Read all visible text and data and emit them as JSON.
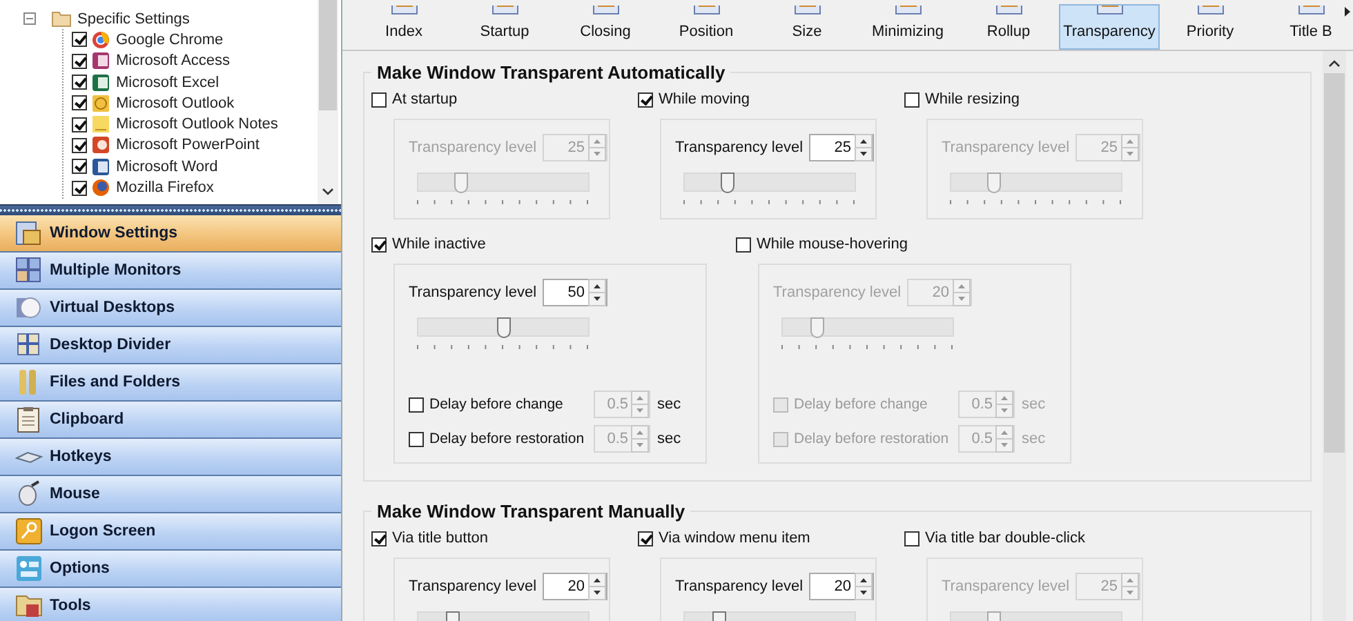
{
  "tree": {
    "items": [
      {
        "label": "Specific Settings",
        "kind": "folder",
        "expanded": true,
        "children": [
          {
            "label": "Google Chrome",
            "checked": true
          },
          {
            "label": "Microsoft Access",
            "checked": true
          },
          {
            "label": "Microsoft Excel",
            "checked": true
          },
          {
            "label": "Microsoft Outlook",
            "checked": true
          },
          {
            "label": "Microsoft Outlook Notes",
            "checked": true
          },
          {
            "label": "Microsoft PowerPoint",
            "checked": true
          },
          {
            "label": "Microsoft Word",
            "checked": true
          },
          {
            "label": "Mozilla Firefox",
            "checked": true
          }
        ]
      }
    ]
  },
  "nav": [
    {
      "label": "Window Settings",
      "selected": true
    },
    {
      "label": "Multiple Monitors",
      "selected": false
    },
    {
      "label": "Virtual Desktops",
      "selected": false
    },
    {
      "label": "Desktop Divider",
      "selected": false
    },
    {
      "label": "Files and Folders",
      "selected": false
    },
    {
      "label": "Clipboard",
      "selected": false
    },
    {
      "label": "Hotkeys",
      "selected": false
    },
    {
      "label": "Mouse",
      "selected": false
    },
    {
      "label": "Logon Screen",
      "selected": false
    },
    {
      "label": "Options",
      "selected": false
    },
    {
      "label": "Tools",
      "selected": false
    }
  ],
  "tabs": [
    {
      "label": "Index",
      "selected": false
    },
    {
      "label": "Startup",
      "selected": false
    },
    {
      "label": "Closing",
      "selected": false
    },
    {
      "label": "Position",
      "selected": false
    },
    {
      "label": "Size",
      "selected": false
    },
    {
      "label": "Minimizing",
      "selected": false
    },
    {
      "label": "Rollup",
      "selected": false
    },
    {
      "label": "Transparency",
      "selected": true
    },
    {
      "label": "Priority",
      "selected": false
    },
    {
      "label": "Title B",
      "selected": false
    }
  ],
  "sections": [
    {
      "title": "Make Window Transparent Automatically",
      "rows": [
        {
          "kind": "small",
          "options": [
            {
              "label": "At startup",
              "checked": false,
              "level_label": "Transparency level",
              "value": "25",
              "level": 0.25
            },
            {
              "label": "While moving",
              "checked": true,
              "level_label": "Transparency level",
              "value": "25",
              "level": 0.25
            },
            {
              "label": "While resizing",
              "checked": false,
              "level_label": "Transparency level",
              "value": "25",
              "level": 0.25
            }
          ]
        },
        {
          "kind": "large",
          "options": [
            {
              "label": "While inactive",
              "checked": true,
              "level_label": "Transparency level",
              "value": "50",
              "level": 0.5,
              "delays": [
                {
                  "label": "Delay before change",
                  "checked": false,
                  "value": "0.5",
                  "unit": "sec"
                },
                {
                  "label": "Delay before restoration",
                  "checked": false,
                  "value": "0.5",
                  "unit": "sec"
                }
              ]
            },
            {
              "label": "While mouse-hovering",
              "checked": false,
              "level_label": "Transparency level",
              "value": "20",
              "level": 0.2,
              "delays": [
                {
                  "label": "Delay before change",
                  "checked": false,
                  "value": "0.5",
                  "unit": "sec"
                },
                {
                  "label": "Delay before restoration",
                  "checked": false,
                  "value": "0.5",
                  "unit": "sec"
                }
              ]
            }
          ]
        }
      ]
    },
    {
      "title": "Make Window Transparent Manually",
      "rows": [
        {
          "kind": "small",
          "options": [
            {
              "label": "Via title button",
              "checked": true,
              "level_label": "Transparency level",
              "value": "20",
              "level": 0.2
            },
            {
              "label": "Via window menu item",
              "checked": true,
              "level_label": "Transparency level",
              "value": "20",
              "level": 0.2
            },
            {
              "label": "Via title bar double-click",
              "checked": false,
              "level_label": "Transparency level",
              "value": "25",
              "level": 0.25
            }
          ]
        }
      ]
    }
  ]
}
